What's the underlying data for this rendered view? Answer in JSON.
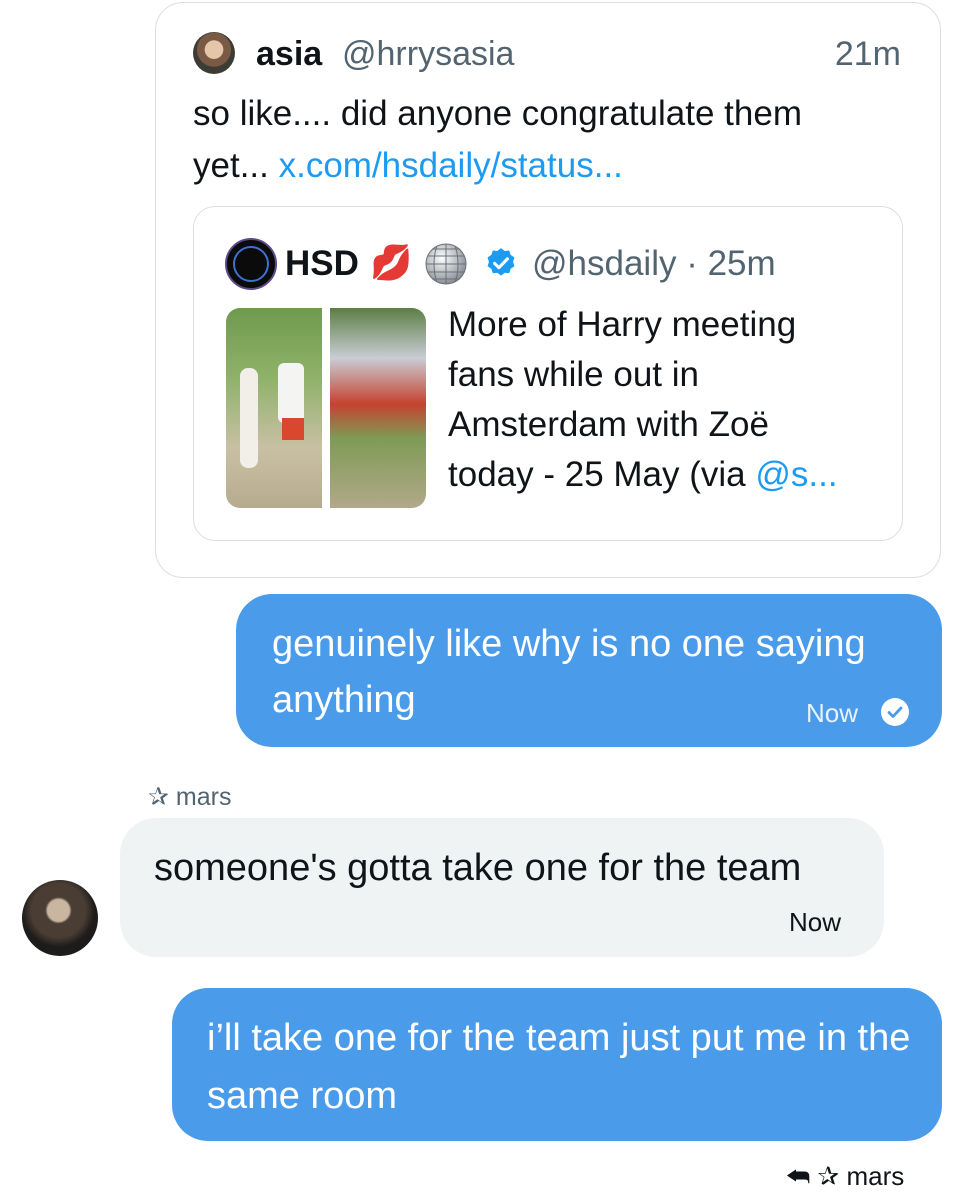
{
  "quoted_dm_tweet": {
    "author_name": "asia",
    "author_handle": "@hrrysasia",
    "time": "21m",
    "text_line1": "so like.... did anyone congratulate them",
    "text_line2_prefix": "yet... ",
    "link": "x.com/hsdaily/status...",
    "embedded": {
      "author_name": "HSD",
      "lips_emoji": "💋",
      "ball_emoji": "🪩",
      "handle_time": "@hsdaily · 25m",
      "text_lines": [
        "More of Harry meeting",
        "fans while out in",
        "Amsterdam with Zoë"
      ],
      "text_last_prefix": "today - 25 May (via ",
      "text_last_link": "@s...",
      "verified_icon": "verified-badge-icon"
    }
  },
  "messages": [
    {
      "text": "genuinely like why is no one saying anything",
      "time": "Now",
      "status_icon": "seen-check-icon"
    },
    {
      "sender": "mars",
      "text": "someone's gotta take one for the team",
      "time": "Now"
    },
    {
      "text": "i’ll take one for the team just put me in the same room"
    }
  ],
  "reply_context": {
    "label": "mars",
    "icons": [
      "reply-arrow-icon",
      "star-icon"
    ]
  },
  "colors": {
    "bubble_out": "#4a9cea",
    "bubble_in": "#eff3f4",
    "link": "#1d9bf0",
    "verified": "#1d9bf0"
  }
}
